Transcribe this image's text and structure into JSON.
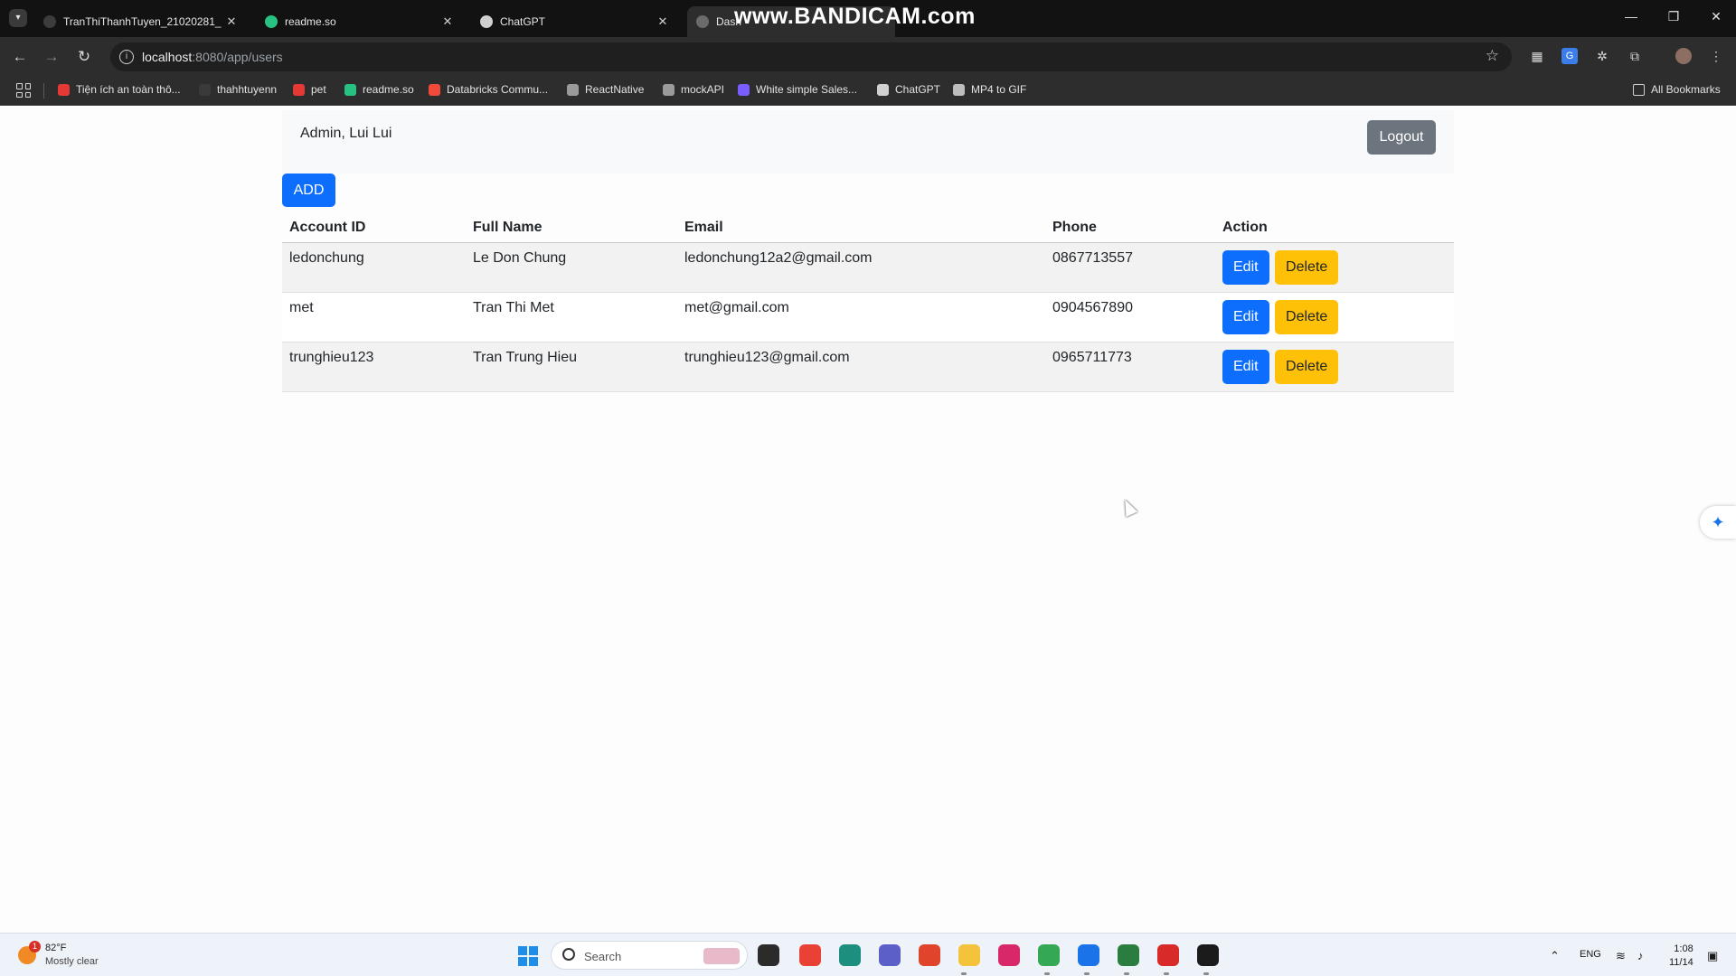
{
  "browser": {
    "tabs": [
      {
        "title": "TranThiThanhTuyen_21020281_",
        "close": "✕",
        "icon_color": "#3c3c3c",
        "active": false
      },
      {
        "title": "readme.so",
        "close": "✕",
        "icon_color": "#27c281",
        "active": false
      },
      {
        "title": "ChatGPT",
        "close": "✕",
        "icon_color": "#d0d0d0",
        "active": false
      },
      {
        "title": "Dash",
        "close": "",
        "icon_color": "#6b6b6b",
        "active": true
      }
    ],
    "watermark": "www.BANDICAM.com",
    "url_host": "localhost",
    "url_path": ":8080/app/users",
    "bookmarks": [
      {
        "label": "Tiện ích an toàn thô...",
        "icon_color": "#e53935"
      },
      {
        "label": "thahhtuyenn",
        "icon_color": "#3a3a3a"
      },
      {
        "label": "pet",
        "icon_color": "#e53935"
      },
      {
        "label": "readme.so",
        "icon_color": "#27c281"
      },
      {
        "label": "Databricks Commu...",
        "icon_color": "#ef4a3a"
      },
      {
        "label": "ReactNative",
        "icon_color": "#9a9a9a"
      },
      {
        "label": "mockAPI",
        "icon_color": "#9a9a9a"
      },
      {
        "label": "White simple Sales...",
        "icon_color": "#7a5cff"
      },
      {
        "label": "ChatGPT",
        "icon_color": "#d0d0d0"
      },
      {
        "label": "MP4 to GIF",
        "icon_color": "#bdbdbd"
      }
    ],
    "all_bookmarks": "All Bookmarks"
  },
  "page": {
    "admin_label": "Admin, Lui Lui",
    "logout_label": "Logout",
    "add_label": "ADD",
    "table": {
      "headers": [
        "Account ID",
        "Full Name",
        "Email",
        "Phone",
        "Action"
      ],
      "rows": [
        {
          "account_id": "ledonchung",
          "full_name": "Le Don Chung",
          "email": "ledonchung12a2@gmail.com",
          "phone": "0867713557"
        },
        {
          "account_id": "met",
          "full_name": "Tran Thi Met",
          "email": "met@gmail.com",
          "phone": "0904567890"
        },
        {
          "account_id": "trunghieu123",
          "full_name": "Tran Trung Hieu",
          "email": "trunghieu123@gmail.com",
          "phone": "0965711773"
        }
      ],
      "edit_label": "Edit",
      "delete_label": "Delete"
    },
    "colors": {
      "primary": "#0d6efd",
      "warning": "#ffc107",
      "secondary": "#6c757d"
    }
  },
  "taskbar": {
    "weather_temp": "82°F",
    "weather_desc": "Mostly clear",
    "weather_badge": "1",
    "search_placeholder": "Search",
    "apps": [
      {
        "name": "file-explorer-icon",
        "color": "#2b2b2b"
      },
      {
        "name": "chrome-icon",
        "color": "#e94235"
      },
      {
        "name": "edge-icon",
        "color": "#1d8f7e"
      },
      {
        "name": "teams-icon",
        "color": "#5b5fc7"
      },
      {
        "name": "office-icon",
        "color": "#e0452b"
      },
      {
        "name": "folder-icon",
        "color": "#f4c23b"
      },
      {
        "name": "intellij-icon",
        "color": "#d9286a"
      },
      {
        "name": "chrome-active-icon",
        "color": "#34a853"
      },
      {
        "name": "zalo-icon",
        "color": "#1a73e8"
      },
      {
        "name": "hs-icon",
        "color": "#2a7d3e"
      },
      {
        "name": "record-icon",
        "color": "#d92a2a"
      },
      {
        "name": "terminal-icon",
        "color": "#1b1b1b"
      }
    ],
    "lang": "ENG",
    "time": "1:08",
    "date": "11/14"
  }
}
